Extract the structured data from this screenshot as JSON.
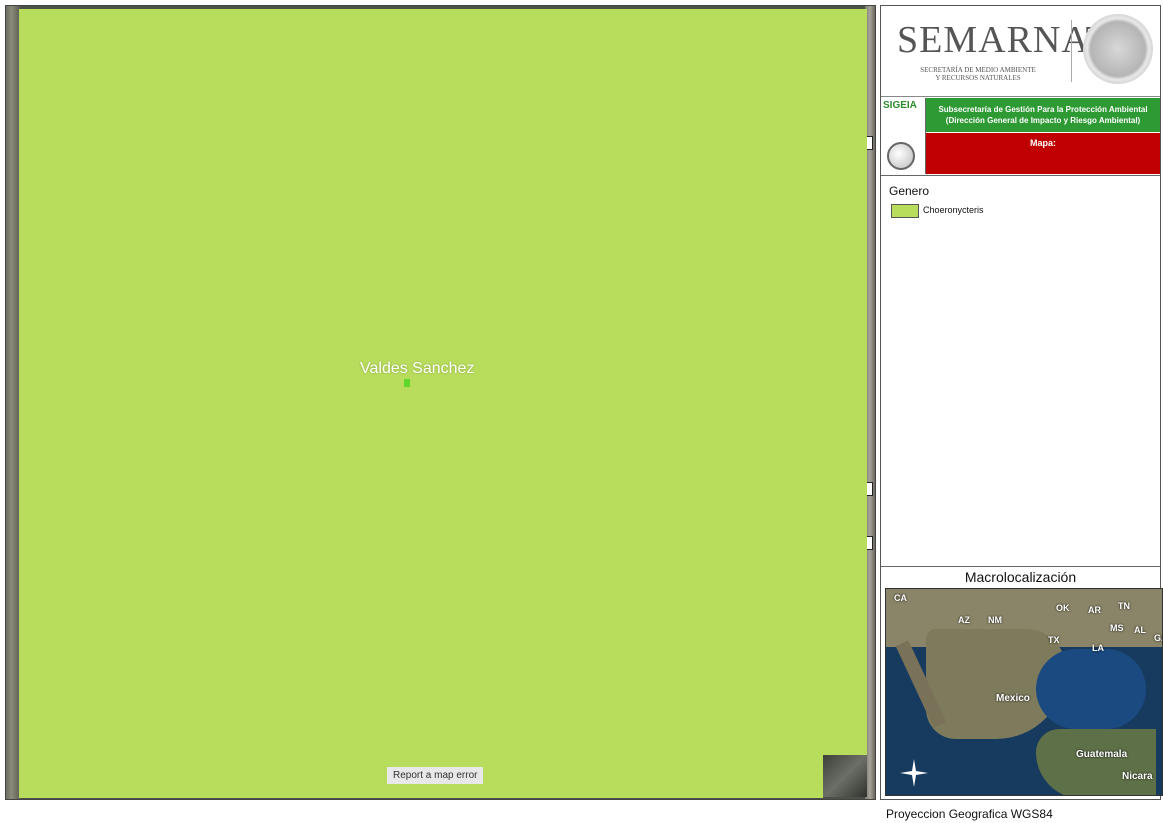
{
  "map": {
    "place_label": "Valdes Sanchez",
    "report_button": "Report a map error",
    "overlay_color": "#b8dc5c",
    "marker_color": "#5fd62b"
  },
  "header": {
    "org_name": "SEMARNAT",
    "org_subtitle_line1": "SECRETARÍA DE MEDIO AMBIENTE",
    "org_subtitle_line2": "Y RECURSOS NATURALES",
    "system_name": "SIGEIA",
    "subsecretaria_line1": "Subsecretaría de Gestión Para la Protección Ambiental",
    "subsecretaria_line2": "(Dirección General de Impacto y Riesgo Ambiental)",
    "mapa_label": "Mapa:",
    "green_color": "#2e9a34",
    "red_color": "#c00000"
  },
  "legend": {
    "title": "Genero",
    "items": [
      {
        "label": "Choeronycteris",
        "color": "#b8dc5c"
      }
    ]
  },
  "macro": {
    "title": "Macrolocalización",
    "labels": [
      "CA",
      "AZ",
      "NM",
      "OK",
      "AR",
      "TN",
      "TX",
      "MS",
      "AL",
      "GA",
      "LA",
      "Mexico",
      "Guatemala",
      "Nicara"
    ],
    "compass_icon": "compass-star-icon"
  },
  "footer": {
    "projection": "Proyeccion Geografica WGS84"
  }
}
